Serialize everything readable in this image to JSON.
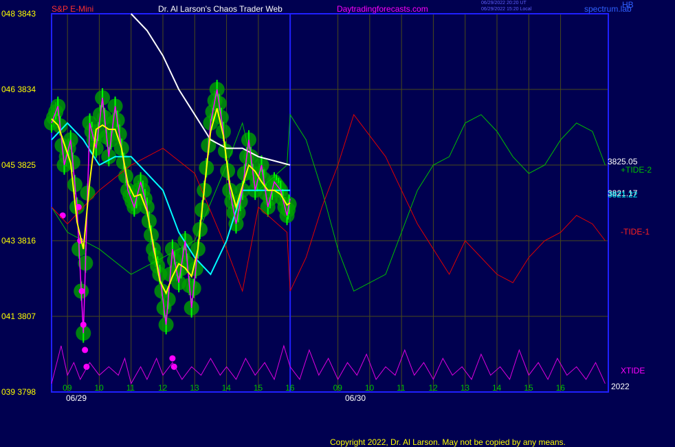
{
  "header": {
    "instrument": "S&P E-Mini",
    "site": "Dr. Al Larson's Chaos Trader Web",
    "url": "Daytradingforecasts.com",
    "timestamp_utc": "06/29/2022 20:20 UT",
    "timestamp_local": "06/29/2022 15:20 Local",
    "brand": "spectrum.lab",
    "corner": "HB"
  },
  "footer": {
    "copyright": "Copyright 2022, Dr. Al Larson. May not be copied by any means."
  },
  "colors": {
    "background": "#000050",
    "grid": "#4a4a1a",
    "frame": "#2020ff",
    "price_bars": "#00ff00",
    "price_line": "#ff00ff",
    "fast_average": "#ffff00",
    "slow_average": "#00ffff",
    "long_average": "#ffffff",
    "tide_plus": "#00c000",
    "tide_minus": "#e00000",
    "xtide": "#e000e0",
    "price_axis_text": "#ffff00",
    "time_axis_text": "#00c000",
    "title_text": "#ffffff",
    "url_text": "#ff00ff",
    "instrument_text": "#ff3030"
  },
  "chart_data": {
    "type": "line",
    "y_axis": {
      "ticks": [
        {
          "left": "039",
          "price": "3798",
          "value": 3798
        },
        {
          "left": "041",
          "price": "3807",
          "value": 3807
        },
        {
          "left": "043",
          "price": "3816",
          "value": 3816
        },
        {
          "left": "045",
          "price": "3825",
          "value": 3825
        },
        {
          "left": "046",
          "price": "3834",
          "value": 3834
        },
        {
          "left": "048",
          "price": "3843",
          "value": 3843
        }
      ],
      "ylim": [
        3798,
        3843
      ]
    },
    "x_axis": {
      "hour_labels": [
        "09",
        "10",
        "11",
        "12",
        "13",
        "14",
        "15",
        "16",
        "09",
        "10",
        "11",
        "12",
        "13",
        "14",
        "15",
        "16"
      ],
      "date_labels": [
        "06/29",
        "06/30"
      ],
      "year": "2022"
    },
    "last_values": [
      "3825.05",
      "3821.17",
      "3821.22"
    ],
    "series": [
      {
        "name": "+TIDE-2",
        "x": [
          8.5,
          9,
          10,
          11,
          12,
          13,
          14,
          14.5,
          15,
          15.9,
          16,
          16.5,
          17,
          17.5,
          18,
          19,
          20,
          20.5,
          21,
          21.5,
          22,
          22.5,
          23,
          23.5,
          24,
          24.5,
          25,
          25.5,
          25.9
        ],
        "values": [
          3820,
          3817,
          3815,
          3812,
          3814,
          3816,
          3825,
          3830,
          3822,
          3825,
          3831,
          3828,
          3822,
          3815,
          3810,
          3812,
          3822,
          3825,
          3826,
          3830,
          3831,
          3829,
          3826,
          3824,
          3825,
          3828,
          3830,
          3829,
          3825
        ]
      },
      {
        "name": "-TIDE-1",
        "x": [
          8.5,
          9,
          10,
          11,
          12,
          13,
          14,
          14.5,
          15,
          15.9,
          16,
          16.5,
          17,
          17.5,
          18,
          19,
          20,
          20.5,
          21,
          21.5,
          22,
          22.5,
          23,
          23.5,
          24,
          24.5,
          25,
          25.5,
          25.9
        ],
        "values": [
          3820,
          3818,
          3822,
          3825,
          3827,
          3824,
          3815,
          3810,
          3820,
          3817,
          3810,
          3814,
          3820,
          3825,
          3831,
          3826,
          3818,
          3815,
          3812,
          3816,
          3814,
          3812,
          3811,
          3814,
          3816,
          3817,
          3819,
          3818,
          3816
        ]
      },
      {
        "name": "XTIDE",
        "x": [
          8.5,
          8.8,
          9,
          9.2,
          9.4,
          9.7,
          10,
          10.3,
          10.6,
          10.8,
          11,
          11.3,
          11.5,
          11.8,
          12,
          12.3,
          12.6,
          12.9,
          13.2,
          13.5,
          13.8,
          14,
          14.3,
          14.6,
          14.9,
          15.2,
          15.5,
          15.8,
          16,
          16.3,
          16.6,
          16.9,
          17.2,
          17.5,
          17.8,
          18.1,
          18.4,
          18.7,
          19,
          19.3,
          19.6,
          19.9,
          20.2,
          20.5,
          20.8,
          21.1,
          21.4,
          21.7,
          22,
          22.3,
          22.6,
          22.9,
          23.2,
          23.5,
          23.8,
          24.1,
          24.4,
          24.7,
          25,
          25.3,
          25.6,
          25.9
        ],
        "values": [
          3799,
          3803.5,
          3800,
          3801.5,
          3799.5,
          3801.5,
          3800,
          3801,
          3800,
          3802,
          3799,
          3801,
          3799.5,
          3802,
          3800,
          3801.5,
          3799.5,
          3801,
          3800,
          3802,
          3800,
          3801,
          3799.5,
          3802,
          3800,
          3801.5,
          3799.5,
          3803.5,
          3801,
          3799.5,
          3803,
          3800,
          3802,
          3799.5,
          3801.5,
          3800,
          3802.5,
          3799.5,
          3801,
          3800,
          3803,
          3800,
          3801.5,
          3799.5,
          3802,
          3800,
          3801,
          3799.5,
          3802.5,
          3800,
          3801,
          3799.5,
          3803,
          3800,
          3801.5,
          3799.5,
          3802,
          3800,
          3801,
          3799.5,
          3801.5,
          3799
        ]
      },
      {
        "name": "slow average",
        "x": [
          8.5,
          9,
          9.5,
          10,
          10.5,
          11,
          11.5,
          12,
          12.5,
          13,
          13.5,
          14,
          14.5,
          15,
          15.5,
          16
        ],
        "values": [
          3828,
          3830,
          3828,
          3825,
          3826,
          3826,
          3824,
          3822,
          3817,
          3814,
          3812,
          3816,
          3822,
          3822,
          3822,
          3822
        ]
      },
      {
        "name": "long average",
        "x": [
          11,
          11.5,
          12,
          12.5,
          13,
          13.5,
          14,
          14.5,
          15,
          15.5,
          16
        ],
        "values": [
          3843,
          3841,
          3838,
          3834,
          3831,
          3828,
          3827,
          3827,
          3826,
          3825.5,
          3825
        ]
      },
      {
        "name": "price",
        "x": [
          8.5,
          8.7,
          8.9,
          9.1,
          9.3,
          9.5,
          9.7,
          9.9,
          10.1,
          10.3,
          10.5,
          10.7,
          10.9,
          11.1,
          11.3,
          11.5,
          11.7,
          11.9,
          12.1,
          12.3,
          12.5,
          12.7,
          12.9,
          13.1,
          13.3,
          13.5,
          13.7,
          13.9,
          14.1,
          14.3,
          14.5,
          14.7,
          14.9,
          15.1,
          15.3,
          15.5,
          15.7,
          15.9,
          16
        ],
        "values": [
          3830,
          3832,
          3825,
          3828,
          3820,
          3805,
          3830,
          3827,
          3833,
          3826,
          3832,
          3827,
          3822,
          3820,
          3823,
          3820,
          3815,
          3812,
          3806,
          3815,
          3811,
          3816,
          3808,
          3815,
          3822,
          3830,
          3834,
          3829,
          3822,
          3818,
          3822,
          3828,
          3822,
          3825,
          3820,
          3823,
          3822,
          3819,
          3821
        ]
      }
    ]
  }
}
